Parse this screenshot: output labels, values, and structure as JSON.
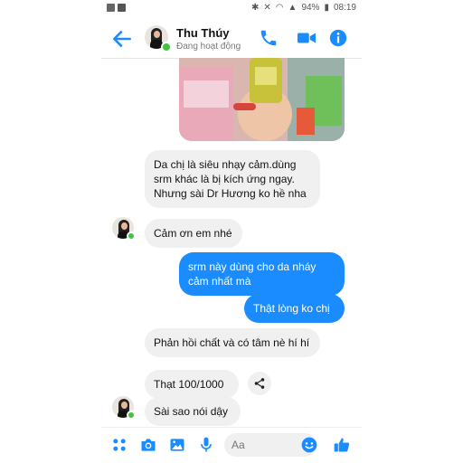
{
  "status_bar": {
    "battery": "94%",
    "time": "08:19"
  },
  "header": {
    "contact_name": "Thu Thúy",
    "contact_status": "Đang hoạt động"
  },
  "messages": [
    {
      "sender": "contact",
      "text": "Da chị là siêu nhạy cảm.dùng srm khác là bị kích ứng ngay. Nhưng sài Dr Hương ko hề nha"
    },
    {
      "sender": "contact",
      "text": "Cảm ơn em nhé"
    },
    {
      "sender": "me",
      "text": "srm này dùng cho da nháy cảm nhất mà"
    },
    {
      "sender": "me",
      "text": "Thật lòng ko chị"
    },
    {
      "sender": "contact",
      "text": "Phản hồi chất và có tâm nè hí hí"
    },
    {
      "sender": "contact",
      "text": "Thạt 100/1000"
    },
    {
      "sender": "contact",
      "text": "Sài sao nói dậy"
    }
  ],
  "composer": {
    "placeholder": "Aa"
  },
  "colors": {
    "accent": "#1a8cff",
    "incoming_bubble": "#f0f0f0",
    "online": "#3ec43e"
  },
  "icons": [
    "back-arrow-icon",
    "phone-icon",
    "video-call-icon",
    "info-icon",
    "share-icon",
    "apps-icon",
    "camera-icon",
    "gallery-icon",
    "microphone-icon",
    "emoji-icon",
    "like-icon"
  ]
}
